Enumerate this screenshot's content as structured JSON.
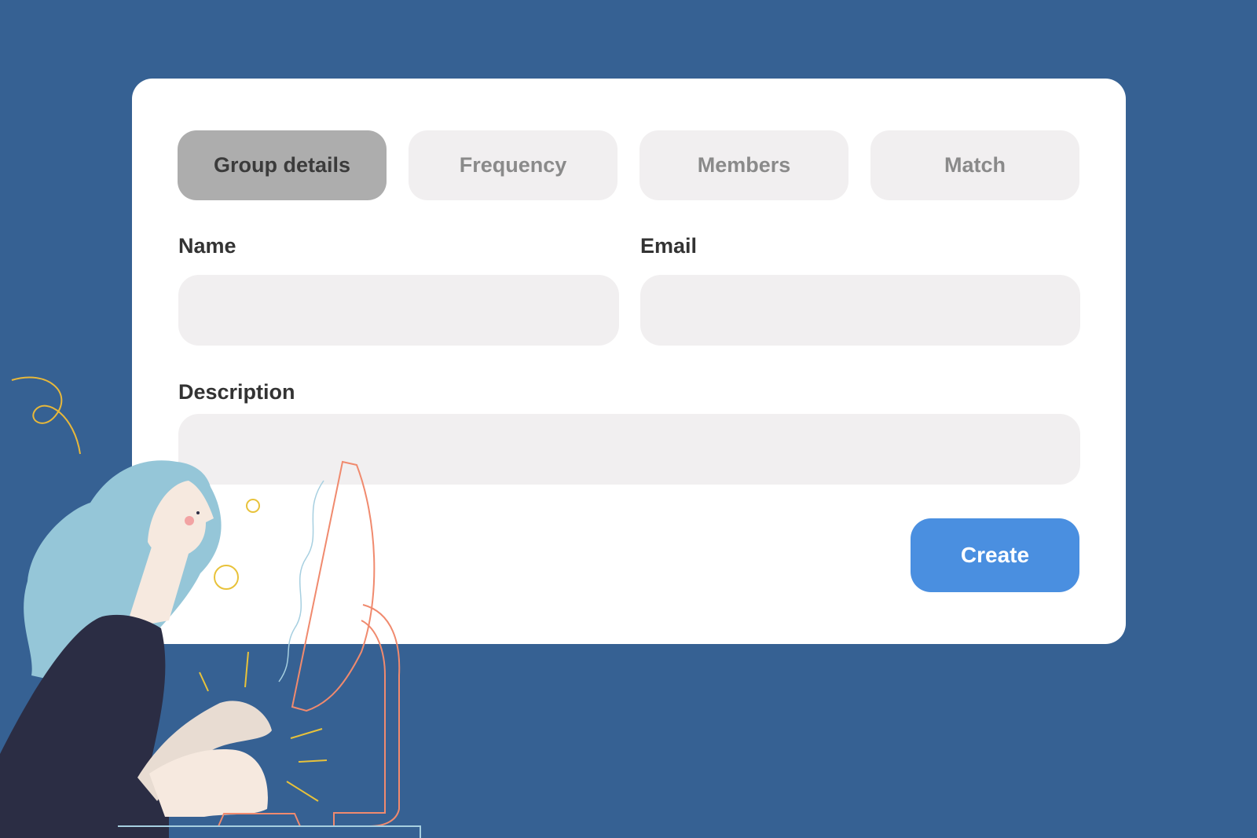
{
  "tabs": [
    {
      "label": "Group details",
      "active": true
    },
    {
      "label": "Frequency",
      "active": false
    },
    {
      "label": "Members",
      "active": false
    },
    {
      "label": "Match",
      "active": false
    }
  ],
  "form": {
    "name_label": "Name",
    "name_value": "",
    "email_label": "Email",
    "email_value": "",
    "description_label": "Description",
    "description_value": ""
  },
  "actions": {
    "create_label": "Create"
  },
  "colors": {
    "background": "#366193",
    "card": "#ffffff",
    "tab_active": "#adadad",
    "tab_inactive": "#f1eff0",
    "field": "#f1eff0",
    "primary": "#4a8fe0"
  },
  "illustration": {
    "icon": "woman-at-computer-illustration"
  }
}
